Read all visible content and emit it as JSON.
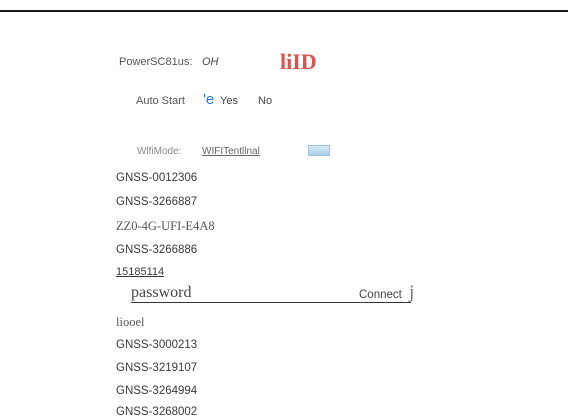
{
  "power": {
    "label": "PowerSC81us:",
    "value": "OH",
    "brand_text": "liID"
  },
  "autostart": {
    "label": "Auto Start",
    "selected_glyph": "'e",
    "yes_label": "Yes",
    "no_label": "No"
  },
  "wifi_mode": {
    "label": "WlfiMode:",
    "value": "WIFITentllnal"
  },
  "networks_top": [
    "GNSS-0012306",
    "GNSS-3266887",
    "ZZ0-4G-UFI-E4A8",
    "GNSS-3266886",
    "15185114"
  ],
  "password_field": {
    "placeholder": "password",
    "connect_label": "Connect",
    "caret_char": "j"
  },
  "networks_bottom": [
    "liooel",
    "GNSS-3000213",
    "GNSS-3219107",
    "GNSS-3264994",
    "GNSS-3268002"
  ],
  "colors": {
    "brand": "#d9534f",
    "radio_accent": "#2a7fd4",
    "rule": "#1a1a1a"
  }
}
